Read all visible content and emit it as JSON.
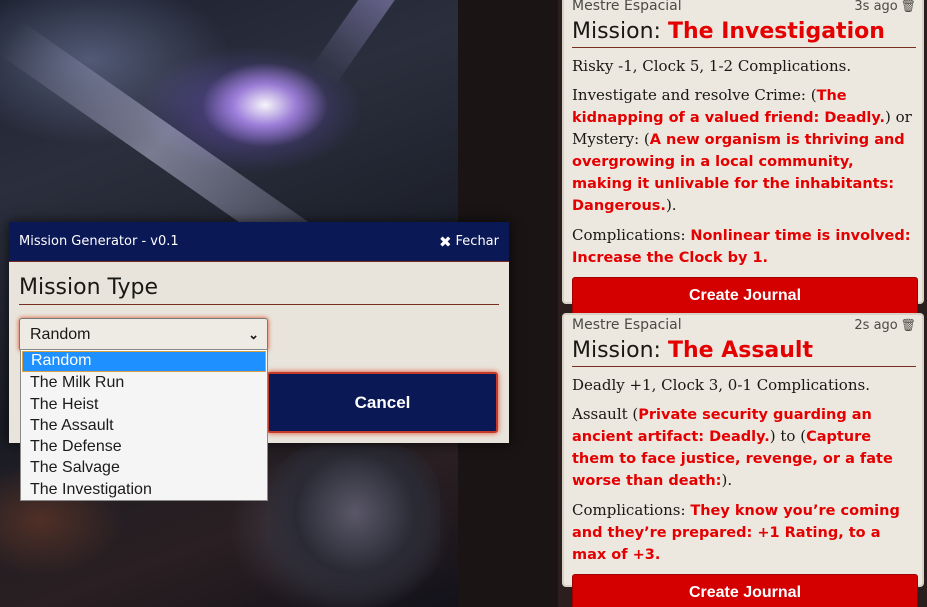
{
  "dialog": {
    "title": "Mission Generator - v0.1",
    "close_label": "Fechar",
    "field_label": "Mission Type",
    "selected_value": "Random",
    "cancel_label": "Cancel",
    "options": [
      "Random",
      "The Milk Run",
      "The Heist",
      "The Assault",
      "The Defense",
      "The Salvage",
      "The Investigation"
    ]
  },
  "messages": [
    {
      "sender": "Mestre Espacial",
      "timestamp": "3s ago",
      "mission_prefix": "Mission:",
      "mission_name": "The Investigation",
      "stats": "Risky -1, Clock 5, 1-2 Complications.",
      "body_1": "Investigate and resolve Crime: (",
      "body_hl_1": "The kidnapping of a valued friend: Deadly.",
      "body_2": ") or Mystery: (",
      "body_hl_2": "A new organism is thriving and overgrowing in a local community, making it unlivable for the inhabitants: Dangerous.",
      "body_3": ").",
      "comp_label": "Complications: ",
      "comp_text": "Nonlinear time is involved: Increase the Clock by 1.",
      "button": "Create Journal"
    },
    {
      "sender": "Mestre Espacial",
      "timestamp": "2s ago",
      "mission_prefix": "Mission:",
      "mission_name": "The Assault",
      "stats": "Deadly +1, Clock 3, 0-1 Complications.",
      "body_1": "Assault (",
      "body_hl_1": "Private security guarding an ancient artifact: Deadly.",
      "body_2": ") to (",
      "body_hl_2": "Capture them to face justice, revenge, or a fate worse than death:",
      "body_3": ").",
      "comp_label": "Complications: ",
      "comp_text": "They know you’re coming and they’re prepared: +1 Rating, to a max of +3.",
      "button": "Create Journal"
    }
  ],
  "icons": {
    "trash": "trash-icon",
    "close": "close-icon",
    "chevron": "chevron-down-icon"
  },
  "colors": {
    "accent_red": "#e40000",
    "dialog_header": "#0b1856",
    "button_red": "#d40000",
    "parchment": "#ece8e0"
  }
}
